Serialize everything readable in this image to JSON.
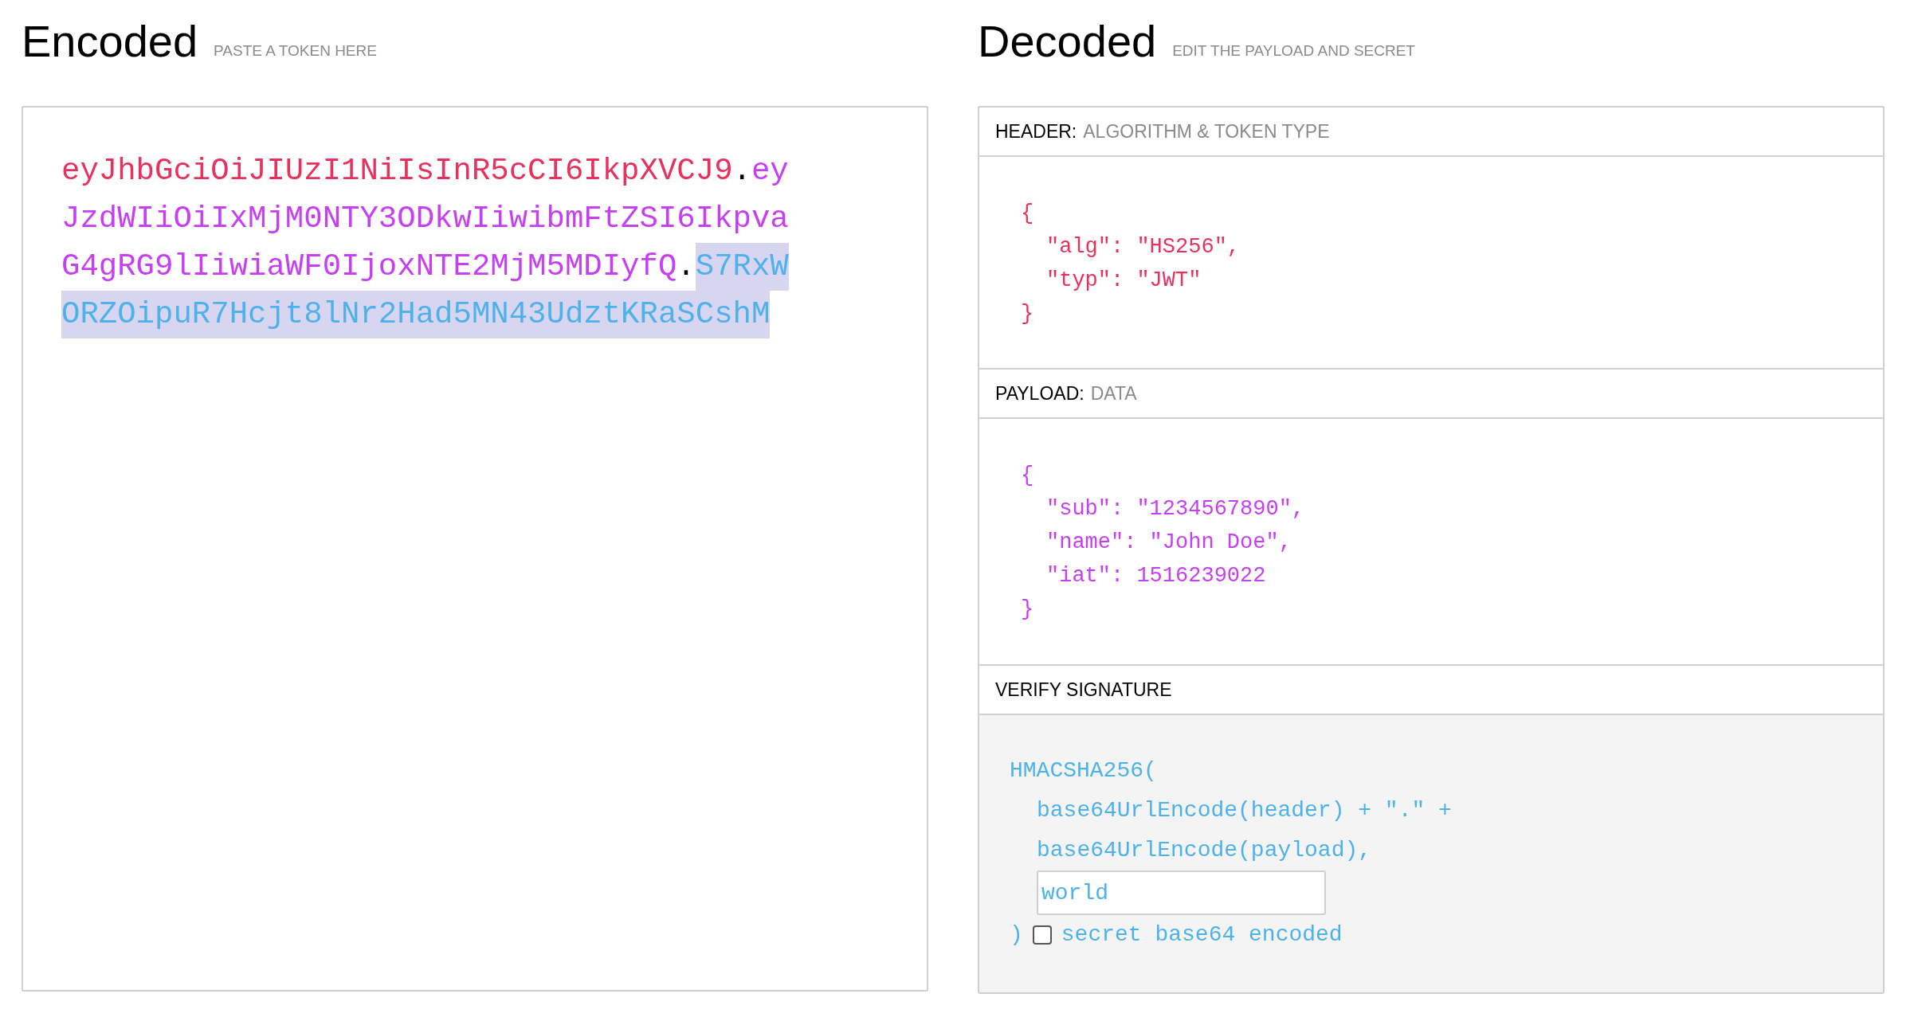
{
  "encoded": {
    "title": "Encoded",
    "hint": "PASTE A TOKEN HERE",
    "token_lines": [
      [
        {
          "text": "eyJhbGciOiJIUzI1NiIsInR5cCI6IkpXVCJ9",
          "color": "#e8315d",
          "selected": false
        },
        {
          "text": ".",
          "color": "#000000",
          "selected": false
        },
        {
          "text": "ey",
          "color": "#c73ff3",
          "selected": false
        }
      ],
      [
        {
          "text": "JzdWIiOiIxMjM0NTY3ODkwIiwibmFtZSI6Ikpva",
          "color": "#c73ff3",
          "selected": false
        }
      ],
      [
        {
          "text": "G4gRG9lIiwiaWF0IjoxNTE2MjM5MDIyfQ",
          "color": "#c73ff3",
          "selected": false
        },
        {
          "text": ".",
          "color": "#000000",
          "selected": false
        },
        {
          "text": "S7RxW",
          "color": "#4eb2ea",
          "selected": true
        }
      ],
      [
        {
          "text": "ORZOipuR7Hcjt8lNr2Had5MN43UdztKRaSCshM",
          "color": "#4eb2ea",
          "selected": true
        }
      ]
    ]
  },
  "decoded": {
    "title": "Decoded",
    "hint": "EDIT THE PAYLOAD AND SECRET",
    "header": {
      "label": "HEADER:",
      "sublabel": "ALGORITHM & TOKEN TYPE",
      "color": "#e8315d",
      "lines": [
        {
          "text": "{",
          "kind": "brace"
        },
        {
          "text": "\"alg\": \"HS256\",",
          "kind": "entry"
        },
        {
          "text": "\"typ\": \"JWT\"",
          "kind": "entry"
        },
        {
          "text": "}",
          "kind": "brace"
        }
      ]
    },
    "payload": {
      "label": "PAYLOAD:",
      "sublabel": "DATA",
      "color": "#c73ff3",
      "lines": [
        {
          "text": "{",
          "kind": "brace"
        },
        {
          "text": "\"sub\": \"1234567890\",",
          "kind": "entry"
        },
        {
          "text": "\"name\": \"John Doe\",",
          "kind": "entry"
        },
        {
          "text": "\"iat\": 1516239022",
          "kind": "entry"
        },
        {
          "text": "}",
          "kind": "brace"
        }
      ]
    },
    "signature": {
      "label": "VERIFY SIGNATURE",
      "color": "#4eb2ea",
      "open": "HMACSHA256(",
      "lines": [
        "base64UrlEncode(header) + \".\" +",
        "base64UrlEncode(payload),"
      ],
      "secret": "world",
      "close": ")",
      "checkbox": {
        "label": "secret base64 encoded",
        "checked": false
      }
    }
  }
}
